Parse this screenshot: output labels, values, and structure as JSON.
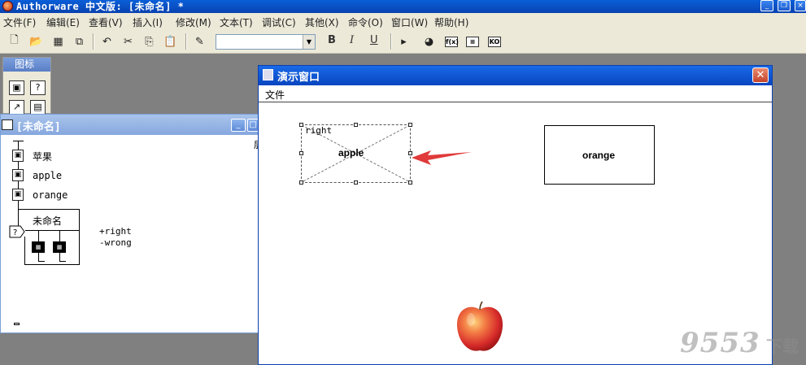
{
  "app": {
    "title": "Authorware 中文版: [未命名] *"
  },
  "menubar": {
    "items": [
      "文件(F)",
      "编辑(E)",
      "查看(V)",
      "插入(I)",
      "修改(M)",
      "文本(T)",
      "调试(C)",
      "其他(X)",
      "命令(O)",
      "窗口(W)",
      "帮助(H)"
    ]
  },
  "toolbar": {
    "font_value": "",
    "bold_label": "B",
    "italic_label": "I",
    "underline_label": "U",
    "buttons": [
      "new-icon",
      "open-icon",
      "save-all-icon",
      "import-icon",
      "undo-icon",
      "cut-icon",
      "copy-icon",
      "paste-icon",
      "find-icon",
      "run-icon",
      "control-panel-icon",
      "functions-icon",
      "variables-icon",
      "knowledge-objects-icon"
    ]
  },
  "palette": {
    "title": "图标"
  },
  "flow_window": {
    "title": "[未命名]",
    "clipped_label": "层",
    "icons": [
      {
        "label": "苹果"
      },
      {
        "label": "apple"
      },
      {
        "label": "orange"
      }
    ],
    "interaction_label": "未命名",
    "responses": [
      "+right",
      "-wrong"
    ]
  },
  "presentation": {
    "title": "演示窗口",
    "menu_file": "文件",
    "target_label": "right",
    "apple_text": "apple",
    "orange_text": "orange"
  },
  "watermark": {
    "text": "9553",
    "suffix": "下载"
  },
  "colors": {
    "titlebar": "#0845c0",
    "arrow": "#e03a3a",
    "close_button": "#c3442a"
  }
}
